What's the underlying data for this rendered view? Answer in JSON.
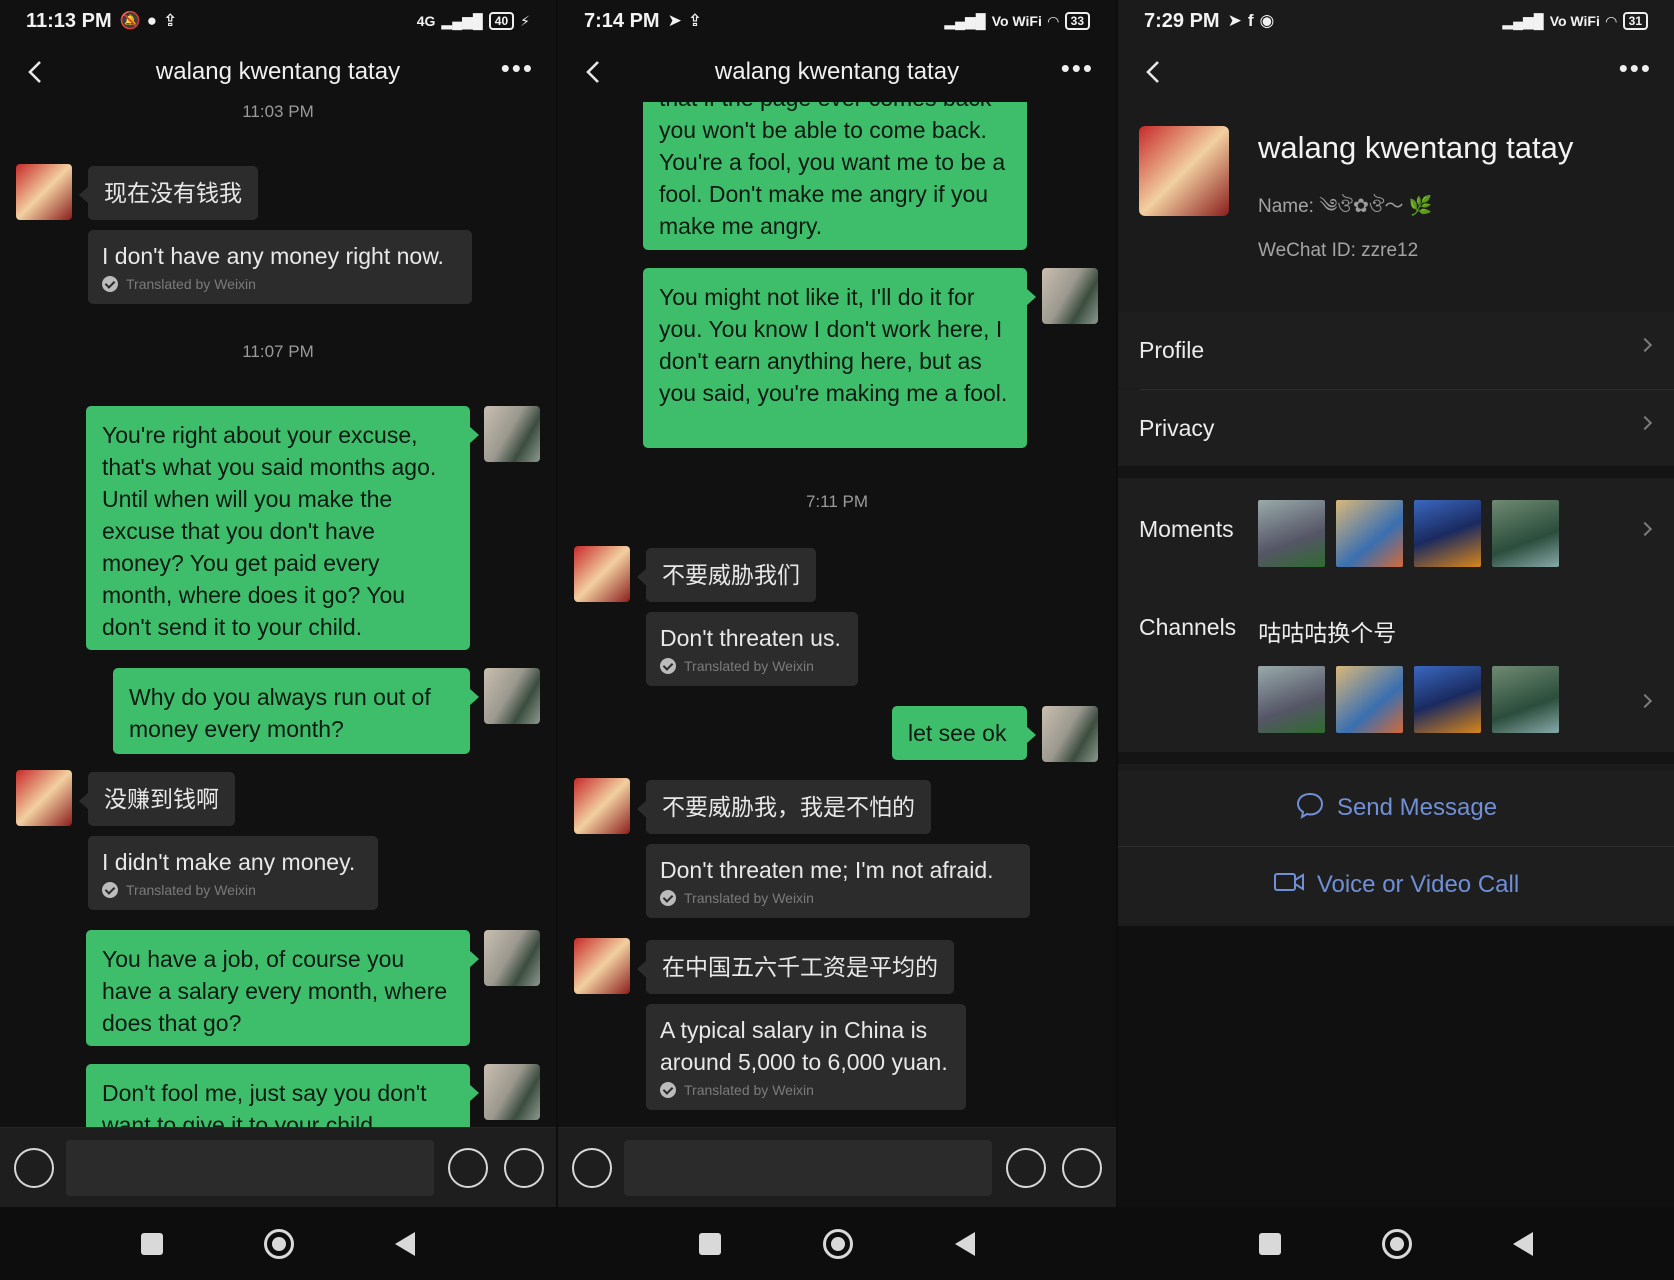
{
  "panes": [
    {
      "status": {
        "time": "11:13 PM",
        "network": "4G",
        "battery": "40"
      },
      "title": "walang kwentang tatay",
      "messages": [
        {
          "timestamp": "11:03 PM"
        },
        {
          "from": "them",
          "text": "现在没有钱我",
          "translation": "I don't have any money right now."
        },
        {
          "timestamp": "11:07 PM"
        },
        {
          "from": "me",
          "text": "You're right about your excuse, that's what you said months ago. Until when will you make the excuse that you don't have money? You get paid every month, where does it go? You don't send it to your child."
        },
        {
          "from": "me",
          "text": "Why do you always run out of money every month?"
        },
        {
          "from": "them",
          "text": "没赚到钱啊",
          "translation": "I didn't make any money."
        },
        {
          "from": "me",
          "text": "You have a job, of course you have a salary every month, where does that go?"
        },
        {
          "from": "me",
          "text": "Don't fool me, just say you don't want to give it to your child"
        }
      ]
    },
    {
      "status": {
        "time": "7:14 PM",
        "wifi_label": "Vo WiFi",
        "battery": "33"
      },
      "title": "walang kwentang tatay",
      "messages": [
        {
          "from": "me",
          "text": "that if the page ever comes back you won't be able to come back. You're a fool, you want me to be a fool. Don't make me angry if you make me angry."
        },
        {
          "from": "me",
          "text": "You might not like it, I'll do it for you. You know I don't work here, I don't earn anything here, but as you said, you're making me a fool."
        },
        {
          "timestamp": "7:11 PM"
        },
        {
          "from": "them",
          "text": "不要威胁我们",
          "translation": "Don't threaten us."
        },
        {
          "from": "me",
          "text": "let see ok"
        },
        {
          "from": "them",
          "text": "不要威胁我，我是不怕的",
          "translation": "Don't threaten me; I'm not afraid."
        },
        {
          "from": "them",
          "text": "在中国五六千工资是平均的",
          "translation": "A typical salary in China is around 5,000 to 6,000 yuan."
        }
      ]
    }
  ],
  "translated_by": "Translated by Weixin",
  "profile": {
    "status": {
      "time": "7:29 PM",
      "wifi_label": "Vo WiFi",
      "battery": "31"
    },
    "name": "walang kwentang tatay",
    "name_label": "Name:",
    "wechat_id_label": "WeChat ID:",
    "wechat_id": "zzre12",
    "rows": {
      "profile": "Profile",
      "privacy": "Privacy",
      "moments": "Moments",
      "channels": "Channels",
      "channel_name": "咕咕咕换个号"
    },
    "actions": {
      "send_message": "Send Message",
      "call": "Voice or Video Call"
    },
    "accent": "#6f8fd6"
  },
  "colors": {
    "bubble_me": "#3ebd6b",
    "bubble_them": "#2c2c2c",
    "background": "#111111"
  },
  "icons": [
    "back-arrow-icon",
    "more-icon",
    "voice-icon",
    "emoji-icon",
    "plus-icon",
    "chat-bubble-icon",
    "video-camera-icon",
    "chevron-right-icon"
  ]
}
